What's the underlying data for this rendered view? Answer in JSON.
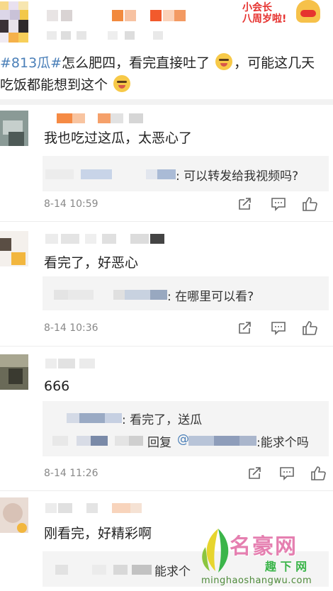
{
  "post": {
    "hashtag": "#813瓜#",
    "text_line1": "怎么肥四，看完直接吐了",
    "text_after_emoji": "，可能这几天",
    "text_line2": "吃饭都能想到这个",
    "badge_line1": "小会长",
    "badge_line2": "八周岁啦!"
  },
  "comments": [
    {
      "body": "我也吃过这瓜，太恶心了",
      "replies": [
        {
          "text": ": 可以转发给我视频吗?"
        }
      ],
      "time": "8-14 10:59"
    },
    {
      "body": "看完了，好恶心",
      "replies": [
        {
          "text": ": 在哪里可以看?"
        }
      ],
      "time": "8-14 10:36"
    },
    {
      "body": "666",
      "replies": [
        {
          "text": ": 看完了，送瓜"
        },
        {
          "prefix": "回复 ",
          "mention": "@",
          "text": ":能求个吗"
        }
      ],
      "time": "8-14 11:26"
    },
    {
      "body": "刚看完，好精彩啊",
      "replies": [
        {
          "text": "能求个"
        }
      ]
    }
  ],
  "watermark": {
    "logo": "名豪网",
    "sub": "趣 下 网",
    "url": "minghaoshangwu.com"
  },
  "icons": [
    "share-icon",
    "comment-icon",
    "like-icon"
  ]
}
